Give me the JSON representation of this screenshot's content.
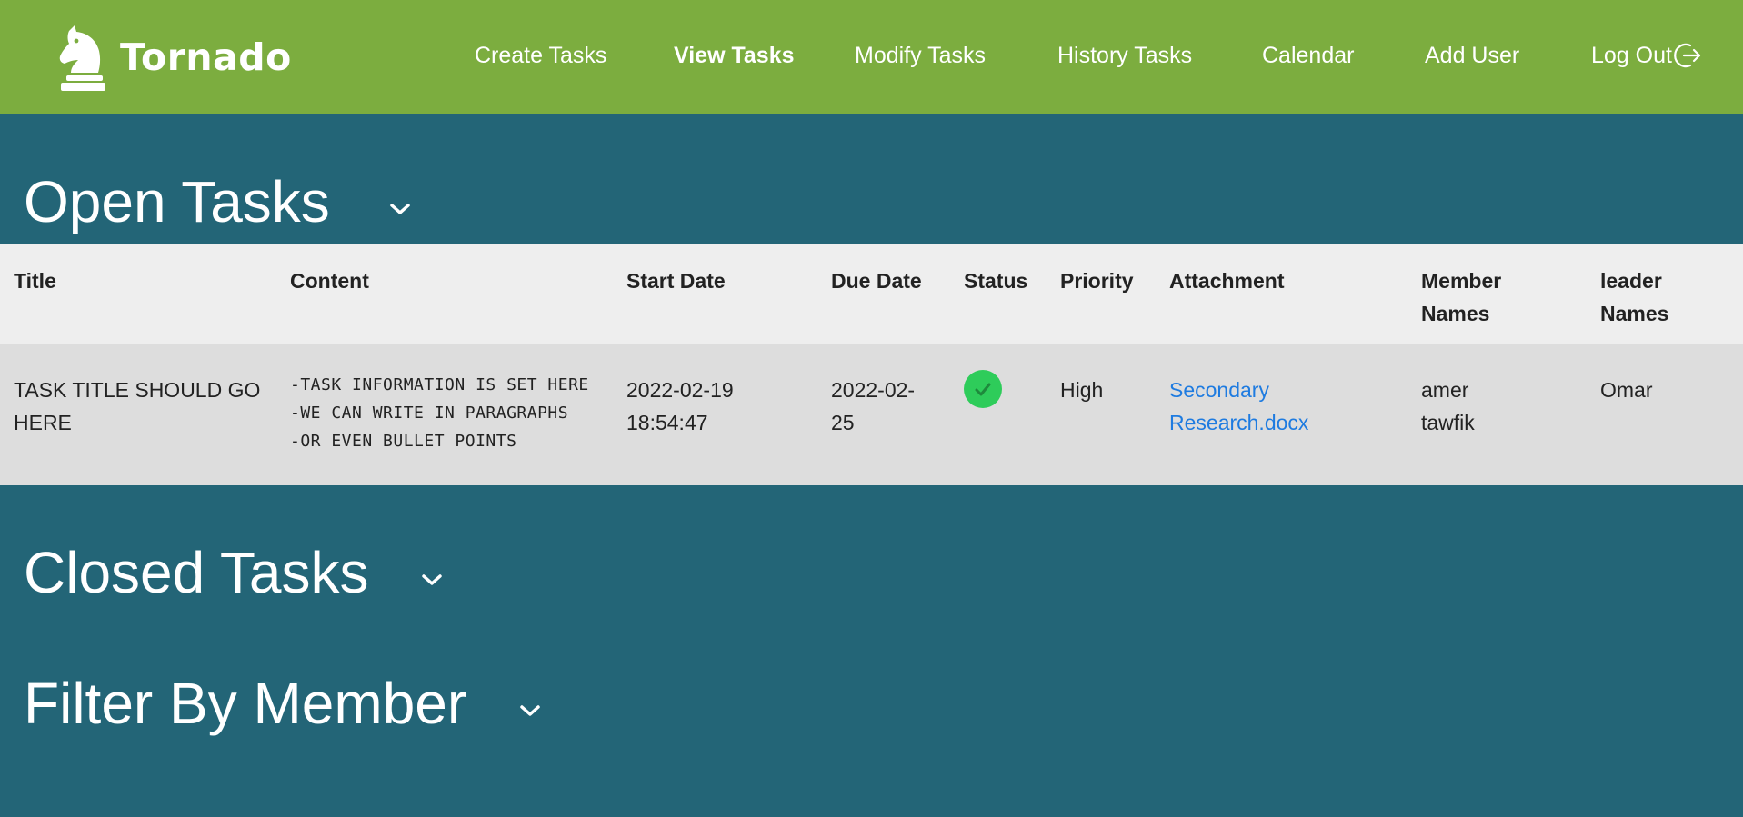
{
  "app": {
    "brand": "Tornado",
    "accent_color": "#7cad3f",
    "background_color": "#236577"
  },
  "nav": {
    "items": [
      {
        "label": "Create Tasks",
        "active": false
      },
      {
        "label": "View Tasks",
        "active": true
      },
      {
        "label": "Modify Tasks",
        "active": false
      },
      {
        "label": "History Tasks",
        "active": false
      },
      {
        "label": "Calendar",
        "active": false
      },
      {
        "label": "Add User",
        "active": false
      }
    ],
    "logout_label": "Log Out",
    "logout_icon": "logout-arrow-icon"
  },
  "sections": {
    "open": {
      "title": "Open Tasks",
      "icon": "chevron-down-icon"
    },
    "closed": {
      "title": "Closed Tasks",
      "icon": "chevron-down-icon"
    },
    "filter": {
      "title": "Filter By Member",
      "icon": "chevron-down-icon"
    }
  },
  "table": {
    "columns": [
      "Title",
      "Content",
      "Start Date",
      "Due Date",
      "Status",
      "Priority",
      "Attachment",
      "Member Names",
      "leader Names"
    ],
    "rows": [
      {
        "title": "TASK TITLE SHOULD GO HERE",
        "content": "-TASK INFORMATION IS SET HERE\n-WE CAN WRITE IN PARAGRAPHS\n-OR EVEN BULLET POINTS",
        "start_date": "2022-02-19 18:54:47",
        "due_date": "2022-02-25",
        "status_icon": "check-circle-icon",
        "status_color": "#2ecc5a",
        "priority": "High",
        "attachment": "Secondary Research.docx",
        "members": [
          "amer",
          "tawfik"
        ],
        "leader": "Omar"
      }
    ]
  }
}
